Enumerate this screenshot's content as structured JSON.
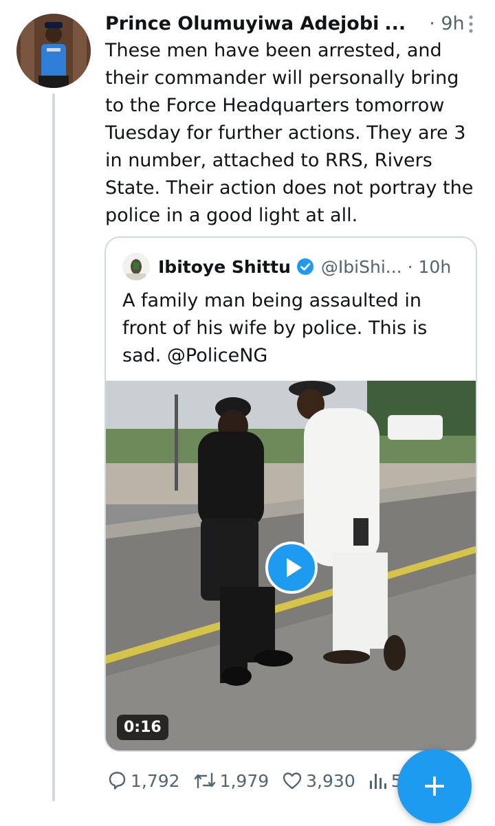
{
  "tweet": {
    "author_name": "Prince Olumuyiwa Adejobi",
    "name_truncation": "...",
    "time": "· 9h",
    "text": "These men have been arrested, and their commander will personally bring to the Force Headquarters tomorrow Tuesday for further actions. They are 3 in number, attached to RRS, Rivers State. Their action does not portray the police in a good light at all."
  },
  "quote": {
    "author_name": "Ibitoye Shittu",
    "handle": "@IbiShi...",
    "time": "· 10h",
    "text": "A family man being assaulted in front of his wife by police. This is sad. @PoliceNG",
    "video_duration": "0:16"
  },
  "actions": {
    "replies": "1,792",
    "reposts": "1,979",
    "likes": "3,930",
    "views": "5"
  },
  "colors": {
    "accent": "#1d9bf0",
    "secondary_text": "#536471",
    "border": "#cfd9de"
  },
  "icons": [
    "more-icon",
    "verified-badge-icon",
    "play-icon",
    "reply-icon",
    "repost-icon",
    "like-icon",
    "views-icon",
    "plus-icon"
  ]
}
